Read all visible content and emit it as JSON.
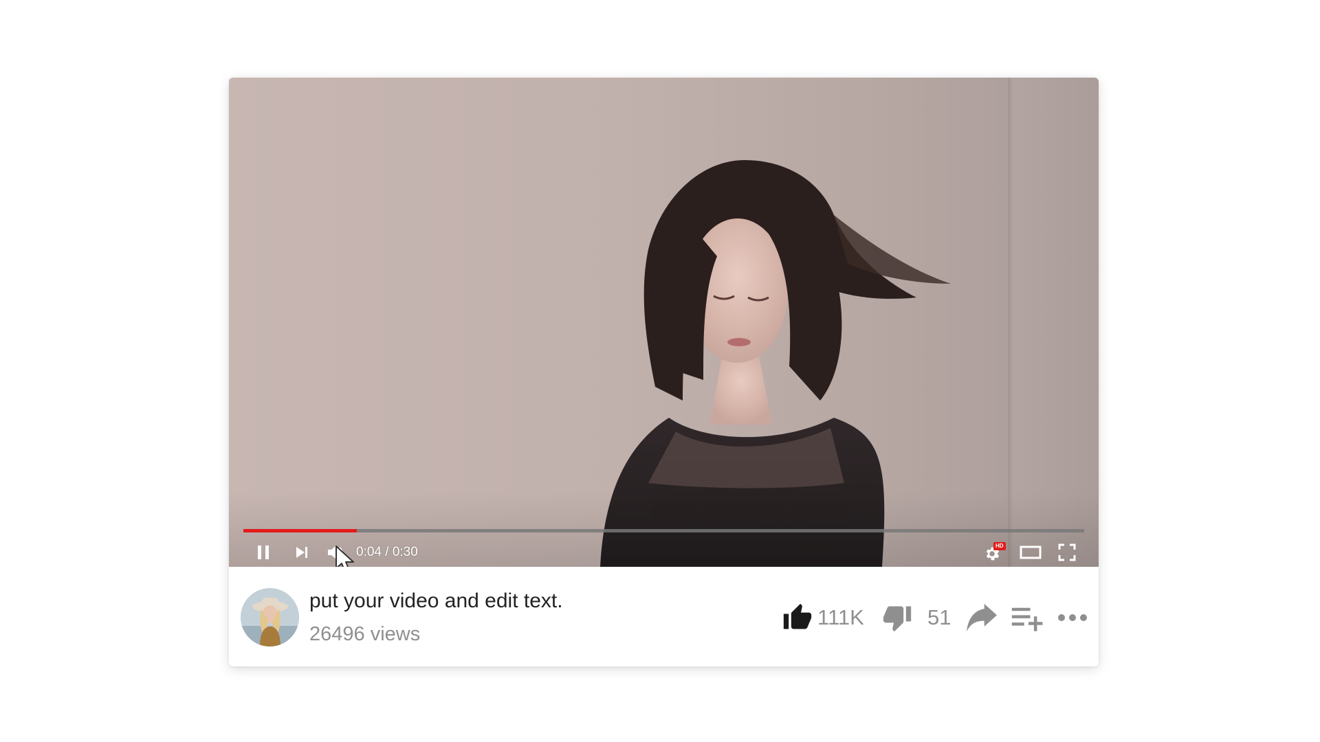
{
  "player": {
    "progress_fraction": 0.135,
    "current_time": "0:04",
    "time_separator": "/",
    "duration": "0:30",
    "time_display": "0:04 / 0:30",
    "settings_badge": "HD",
    "controls": {
      "pause_icon": "pause-icon",
      "next_icon": "skip-next-icon",
      "volume_icon": "volume-icon",
      "settings_icon": "gear-icon",
      "theater_icon": "theater-mode-icon",
      "fullscreen_icon": "fullscreen-icon"
    },
    "colors": {
      "progress": "#e21b1b",
      "badge": "#e21b1b"
    }
  },
  "video": {
    "title": "put your video and edit text.",
    "views": "26496 views"
  },
  "actions": {
    "like_count": "111K",
    "dislike_count": "51",
    "like_icon": "thumbs-up-icon",
    "dislike_icon": "thumbs-down-icon",
    "share_icon": "share-arrow-icon",
    "playlist_icon": "add-to-playlist-icon",
    "more_icon": "more-horizontal-icon"
  }
}
